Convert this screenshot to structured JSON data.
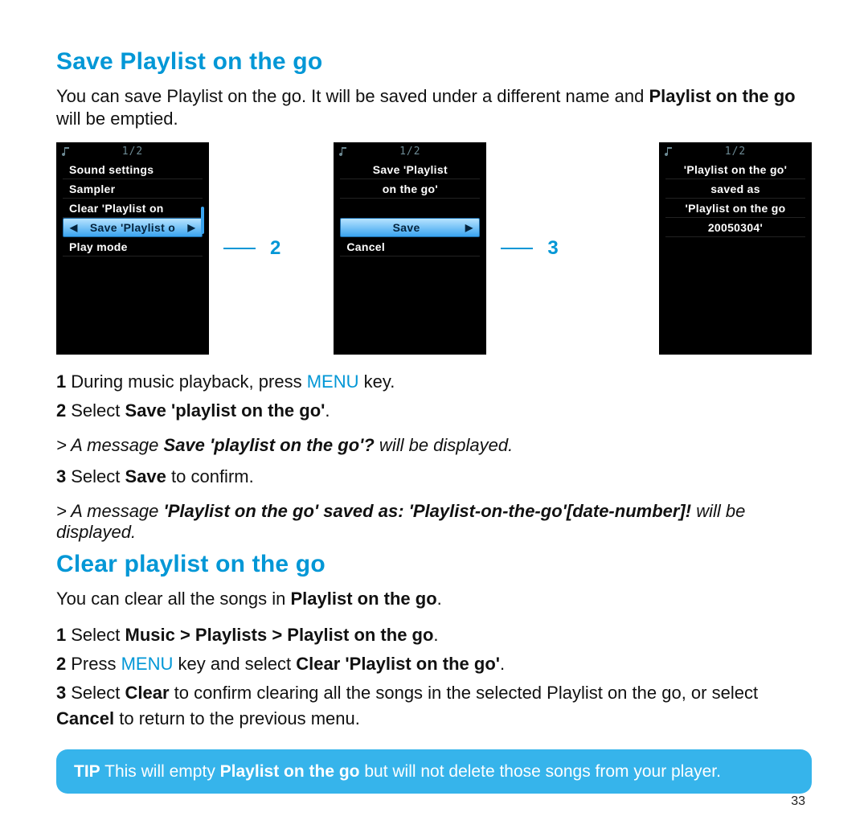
{
  "section1": {
    "heading": "Save Playlist on the go",
    "intro_a": "You can save Playlist on the go. It will be saved under a different name and ",
    "intro_bold": "Playlist on the go",
    "intro_b": " will be emptied."
  },
  "screens": {
    "pos": "1/2",
    "s1": {
      "r1": "Sound settings",
      "r2": "Sampler",
      "r3": "Clear 'Playlist on",
      "sel": "Save 'Playlist o",
      "r5": "Play mode"
    },
    "callout1": "2",
    "s2": {
      "t1": "Save 'Playlist",
      "t2": "on the go'",
      "sel": "Save",
      "r2": "Cancel"
    },
    "callout2": "3",
    "s3": {
      "t1": "'Playlist on the go'",
      "t2": "saved as",
      "t3": "'Playlist on the go",
      "t4": "20050304'"
    }
  },
  "steps1": {
    "n1": "1",
    "s1a": "During music playback, press ",
    "s1menu": "MENU",
    "s1b": " key.",
    "n2": "2",
    "s2a": "Select ",
    "s2bold": "Save 'playlist on the go'",
    "s2b": ".",
    "r1_gt": "> ",
    "r1a": "A message ",
    "r1bold": "Save 'playlist on the go'?",
    "r1b": " will be displayed.",
    "n3": "3",
    "s3a": "Select ",
    "s3bold": "Save",
    "s3b": " to confirm.",
    "r2_gt": "> ",
    "r2a": "A message ",
    "r2bold": "'Playlist on the go' saved as: 'Playlist-on-the-go'[date-number]!",
    "r2b": " will be displayed."
  },
  "section2": {
    "heading": "Clear playlist on the go",
    "intro_a": "You can clear all the songs in ",
    "intro_bold": "Playlist on the go",
    "intro_b": "."
  },
  "steps2": {
    "n1": "1",
    "s1a": "Select ",
    "s1bold": "Music > Playlists > Playlist on the go",
    "s1b": ".",
    "n2": "2",
    "s2a": "Press ",
    "s2menu": "MENU",
    "s2b": " key and select ",
    "s2bold": "Clear 'Playlist on the go'",
    "s2c": ".",
    "n3": "3",
    "s3a": "Select ",
    "s3bold": "Clear",
    "s3b": " to confirm clearing all the songs in the selected Playlist on the go, or select ",
    "s3bold2": "Cancel",
    "s3c": " to return to the previous menu."
  },
  "tip": {
    "label": "TIP",
    "a": " This will empty ",
    "bold": "Playlist on the go",
    "b": " but will not delete those songs from your player."
  },
  "pagenum": "33"
}
